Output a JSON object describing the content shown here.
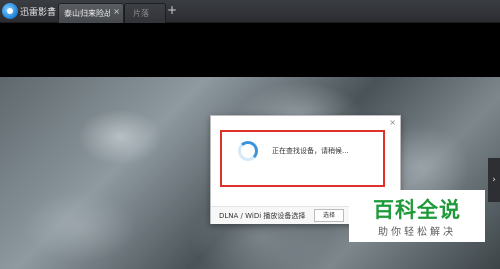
{
  "app": {
    "name": "迅雷影音",
    "caret": "▾"
  },
  "tabs": [
    {
      "label": "泰山归来险战",
      "close": "×",
      "active": true
    },
    {
      "label": "片落",
      "active": false
    }
  ],
  "new_tab": "+",
  "right_handle": "›",
  "dialog": {
    "close": "×",
    "status_text": "正在查找设备，请稍候...",
    "footer_label": "DLNA / WiDi 播放设备选择",
    "select_button": "选择"
  },
  "watermark": {
    "title": "百科全说",
    "subtitle": "助你轻松解决"
  },
  "colors": {
    "highlight": "#e0302a",
    "spinner": "#3b95dc",
    "watermark": "#1f9a3a"
  }
}
